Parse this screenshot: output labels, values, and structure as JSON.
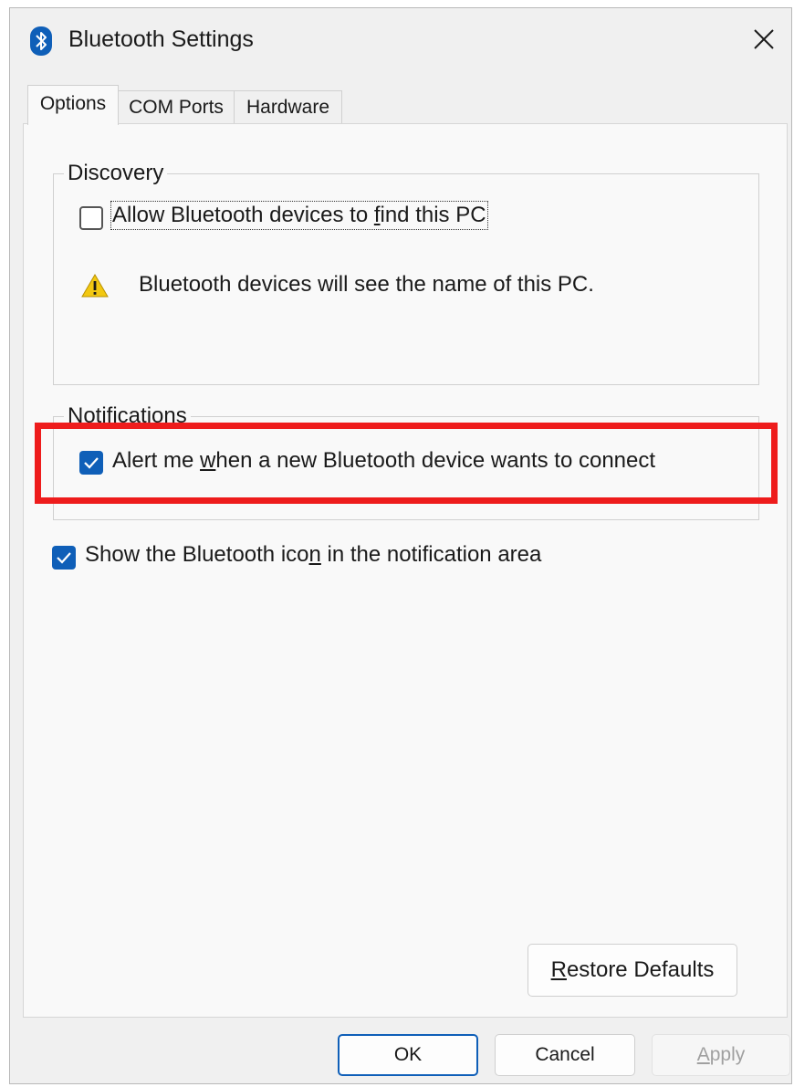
{
  "window": {
    "title": "Bluetooth Settings"
  },
  "tabs": [
    {
      "label": "Options",
      "selected": true
    },
    {
      "label": "COM Ports",
      "selected": false
    },
    {
      "label": "Hardware",
      "selected": false
    }
  ],
  "discovery": {
    "group_label": "Discovery",
    "allow_find": {
      "label": "Allow Bluetooth devices to find this PC",
      "accelerator": "f",
      "checked": false
    },
    "warning_text": "Bluetooth devices will see the name of this PC."
  },
  "notifications": {
    "group_label": "Notifications",
    "alert_connect": {
      "label": "Alert me when a new Bluetooth device wants to connect",
      "accelerator": "w",
      "checked": true
    }
  },
  "show_icon": {
    "label": "Show the Bluetooth icon in the notification area",
    "accelerator": "n",
    "checked": true
  },
  "buttons": {
    "restore_defaults": "Restore Defaults",
    "ok": "OK",
    "cancel": "Cancel",
    "apply": "Apply"
  },
  "colors": {
    "accent": "#0f5fb8",
    "highlight": "#ee1c1c",
    "warning": "#f2c811"
  },
  "icons": {
    "title": "bluetooth-icon",
    "close": "close-icon",
    "warning": "warning-icon",
    "check": "check-icon"
  }
}
